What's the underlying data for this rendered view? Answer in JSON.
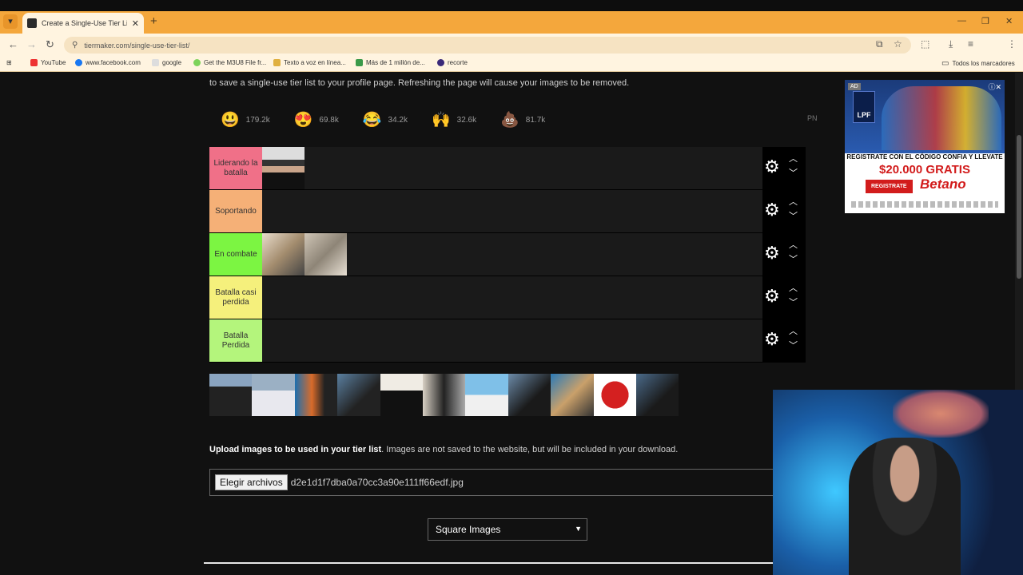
{
  "browser": {
    "tab_title": "Create a Single-Use Tier List (F",
    "url": "tiermaker.com/single-use-tier-list/",
    "bookmarks": [
      "YouTube",
      "www.facebook.com",
      "google",
      "Get the M3U8 File fr...",
      "Texto a voz en línea...",
      "Más de 1 millón de...",
      "recorte"
    ],
    "bookmarks_folder": "Todos los marcadores"
  },
  "page": {
    "note": "to save a single-use tier list to your profile page. Refreshing the page will cause your images to be removed.",
    "reactions": [
      {
        "icon": "😃",
        "count": "179.2k"
      },
      {
        "icon": "😍",
        "count": "69.8k"
      },
      {
        "icon": "😂",
        "count": "34.2k"
      },
      {
        "icon": "🙌",
        "count": "32.6k"
      },
      {
        "icon": "💩",
        "count": "81.7k"
      }
    ],
    "pn_label": "PN",
    "tiers": [
      {
        "label": "Liderando la batalla",
        "color": "#f07088",
        "items": 1
      },
      {
        "label": "Soportando",
        "color": "#f5b077",
        "items": 0
      },
      {
        "label": "En combate",
        "color": "#7cf542",
        "items": 2
      },
      {
        "label": "Batalla casi perdida",
        "color": "#f5f07c",
        "items": 0
      },
      {
        "label": "Batalla Perdida",
        "color": "#b4f57c",
        "items": 0
      }
    ],
    "upload_title": "Upload images to be used in your tier list",
    "upload_desc": "Images are not saved to the website, but will be included in your download.",
    "file_button": "Elegir archivos",
    "file_name": "d2e1d1f7dba0a70cc3a90e111ff66edf.jpg",
    "image_shape": "Square Images"
  },
  "ad": {
    "badge": "AD",
    "logo": "LPF",
    "line1": "REGISTRATE CON EL CÓDIGO CONFIA Y LLEVATE",
    "line2": "$20.000 GRATIS",
    "button": "REGISTRATE",
    "brand": "Betano"
  }
}
